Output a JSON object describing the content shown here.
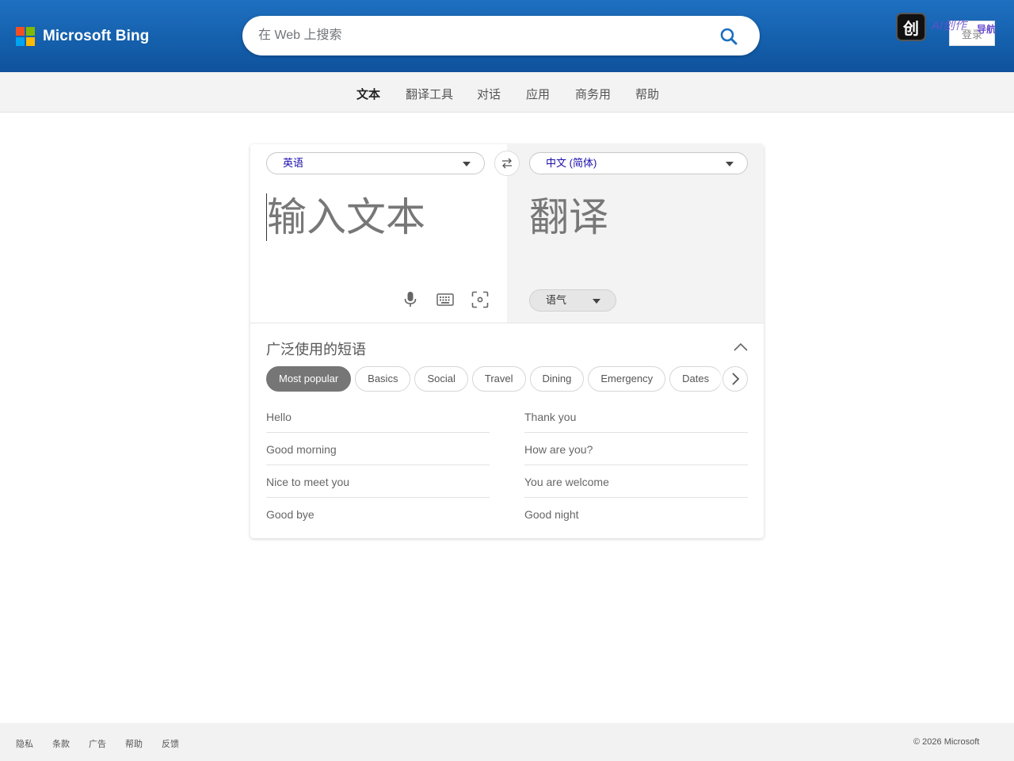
{
  "header": {
    "brand": "Microsoft Bing",
    "search_placeholder": "在 Web 上搜索",
    "search_icon": "search-icon",
    "overlay_badge_glyph": "创",
    "overlay_badge_text": "AI创作",
    "overlay_badge_sub": "导航",
    "signin_label": "登录"
  },
  "nav": {
    "items": [
      "文本",
      "翻译工具",
      "对话",
      "应用",
      "商务用",
      "帮助"
    ],
    "active": "文本"
  },
  "translator": {
    "source_lang": "英语",
    "target_lang": "中文 (简体)",
    "source_placeholder": "输入文本",
    "target_placeholder": "翻译",
    "tone_label": "语气",
    "icons": [
      "microphone-icon",
      "keyboard-icon",
      "camera-scan-icon",
      "swap-icon"
    ]
  },
  "phrases": {
    "title": "广泛使用的短语",
    "categories": [
      "Most popular",
      "Basics",
      "Social",
      "Travel",
      "Dining",
      "Emergency",
      "Dates"
    ],
    "active_category": "Most popular",
    "left": [
      "Hello",
      "Good morning",
      "Nice to meet you",
      "Good bye"
    ],
    "right": [
      "Thank you",
      "How are you?",
      "You are welcome",
      "Good night"
    ]
  },
  "footer": {
    "links": [
      "隐私",
      "条款",
      "广告",
      "帮助",
      "反馈"
    ],
    "copyright": "© 2026 Microsoft"
  },
  "colors": {
    "header_blue": "#1560ad",
    "link_blue": "#1a0dab",
    "active_chip": "#767676"
  }
}
